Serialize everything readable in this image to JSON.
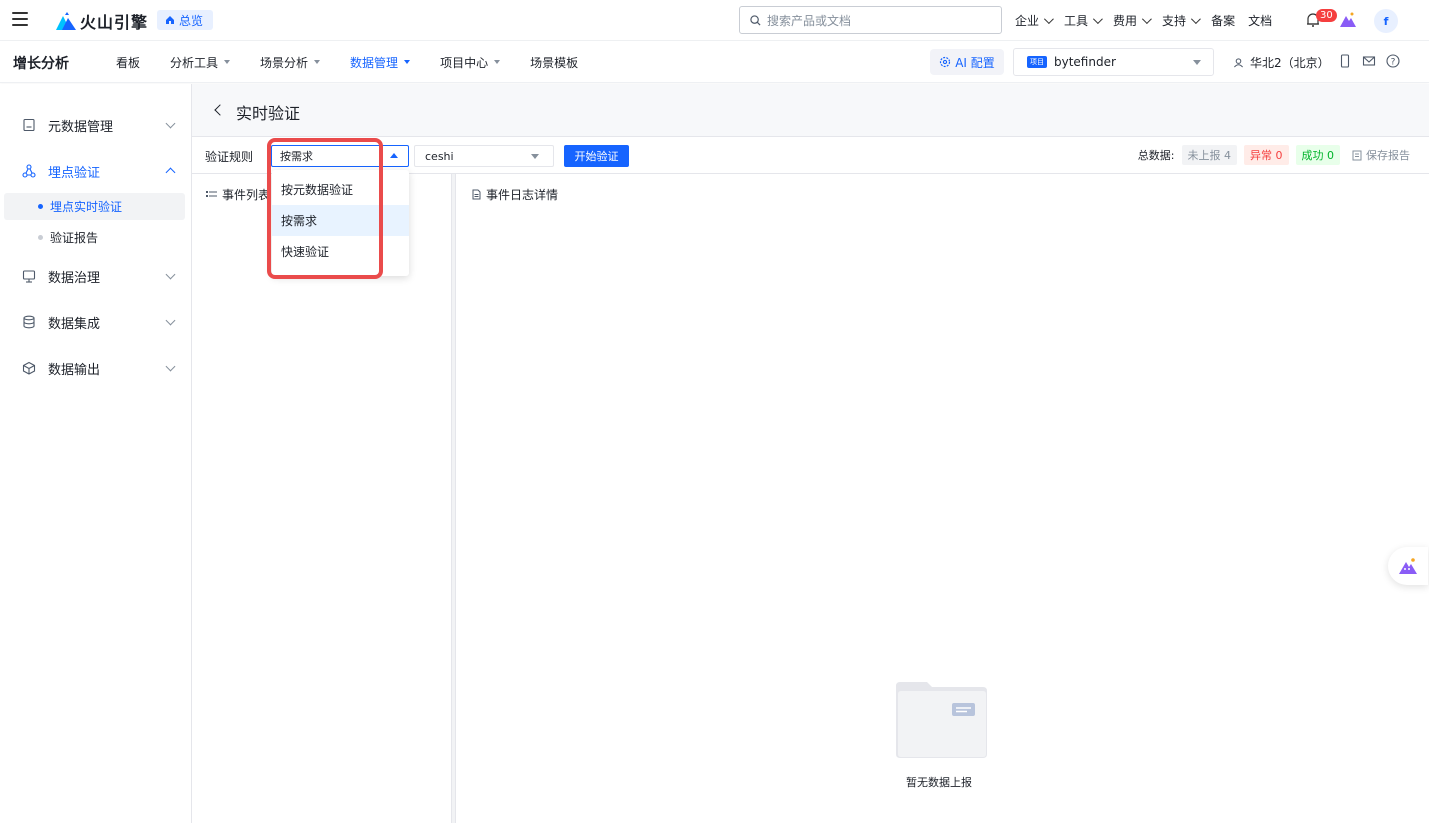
{
  "top": {
    "logo_text": "火山引擎",
    "home_label": "总览",
    "search_placeholder": "搜索产品或文档",
    "links": [
      "企业",
      "工具",
      "费用",
      "支持",
      "备案",
      "文档"
    ],
    "notification_count": "30",
    "avatar_letter": "f"
  },
  "nav": {
    "product": "增长分析",
    "items": [
      "看板",
      "分析工具",
      "场景分析",
      "数据管理",
      "项目中心",
      "场景模板"
    ],
    "ai_label": "AI 配置",
    "project_tag": "项目",
    "project_name": "bytefinder",
    "region": "华北2（北京）"
  },
  "sidebar": {
    "groups": [
      "元数据管理",
      "埋点验证",
      "数据治理",
      "数据集成",
      "数据输出"
    ],
    "sub_items": [
      "埋点实时验证",
      "验证报告"
    ]
  },
  "page": {
    "title": "实时验证",
    "rule_label": "验证规则",
    "rule_value": "按需求",
    "ceshi_value": "ceshi",
    "start_btn": "开始验证",
    "total_label": "总数据:",
    "stat_unreported": "未上报 4",
    "stat_error": "异常 0",
    "stat_success": "成功 0",
    "save_report": "保存报告",
    "event_list": "事件列表",
    "log_detail": "事件日志详情",
    "empty_text": "暂无数据上报"
  },
  "dropdown": {
    "options": [
      "按元数据验证",
      "按需求",
      "快速验证"
    ]
  },
  "colors": {
    "primary": "#1664ff",
    "highlight": "#ea4b4b"
  }
}
